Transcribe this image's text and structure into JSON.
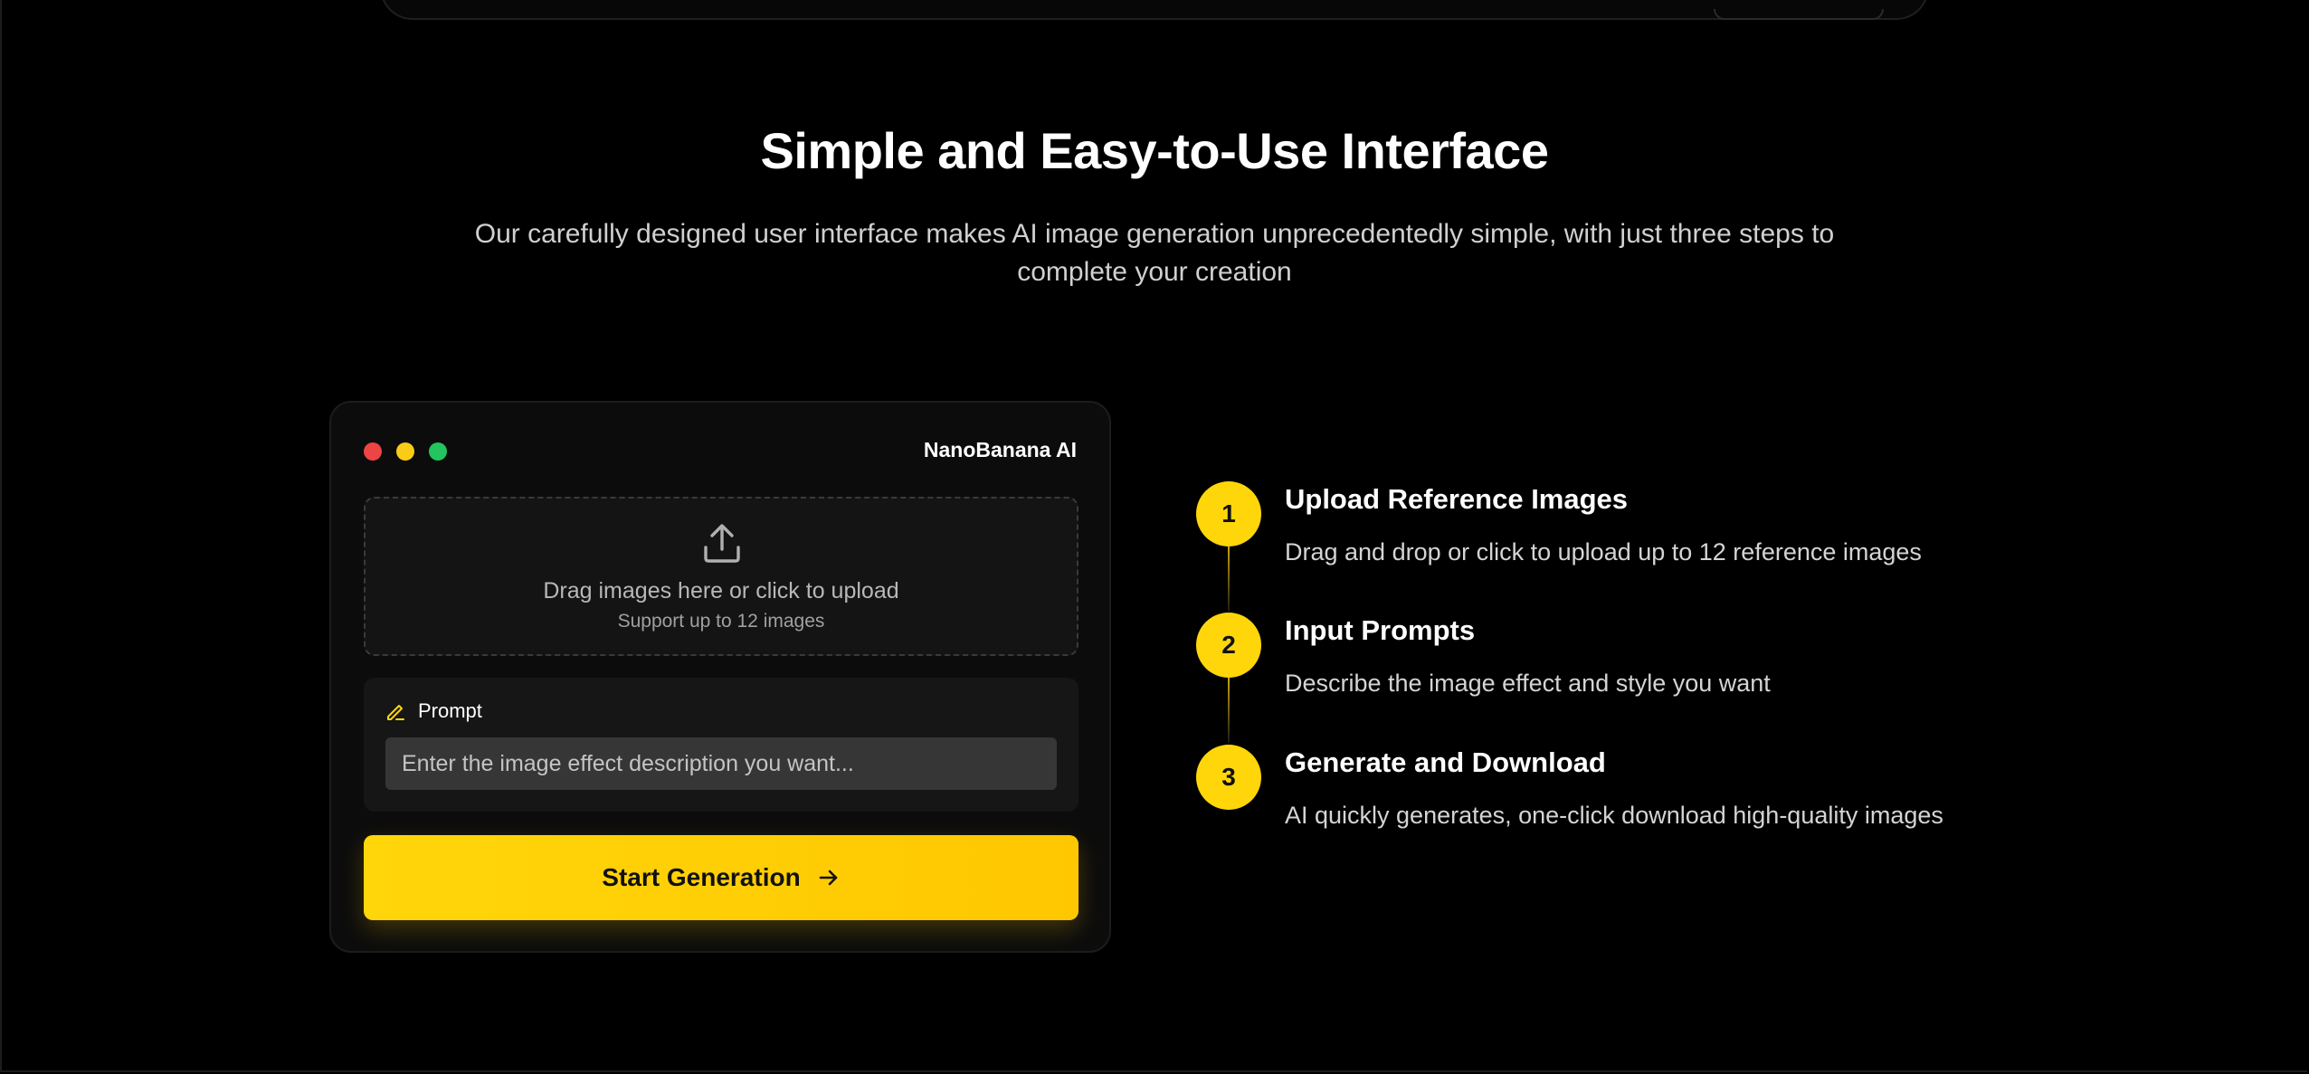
{
  "section": {
    "title": "Simple and Easy-to-Use Interface",
    "subtitle": "Our carefully designed user interface makes AI image generation unprecedentedly simple, with just three steps to complete your creation"
  },
  "mock_window": {
    "title": "NanoBanana AI",
    "traffic_lights": [
      "#ef4444",
      "#facc15",
      "#22c55e"
    ],
    "upload": {
      "icon": "upload-icon",
      "text": "Drag images here or click to upload",
      "hint": "Support up to 12 images"
    },
    "prompt": {
      "icon": "pencil-icon",
      "label": "Prompt",
      "placeholder": "Enter the image effect description you want...",
      "value": ""
    },
    "start_button": {
      "label": "Start Generation",
      "icon": "arrow-right-icon"
    }
  },
  "steps": [
    {
      "number": "1",
      "title": "Upload Reference Images",
      "description": "Drag and drop or click to upload up to 12 reference images"
    },
    {
      "number": "2",
      "title": "Input Prompts",
      "description": "Describe the image effect and style you want"
    },
    {
      "number": "3",
      "title": "Generate and Download",
      "description": "AI quickly generates, one-click download high-quality images"
    }
  ],
  "colors": {
    "accent": "#ffd60a",
    "background": "#000000",
    "card": "#0c0c0c"
  }
}
